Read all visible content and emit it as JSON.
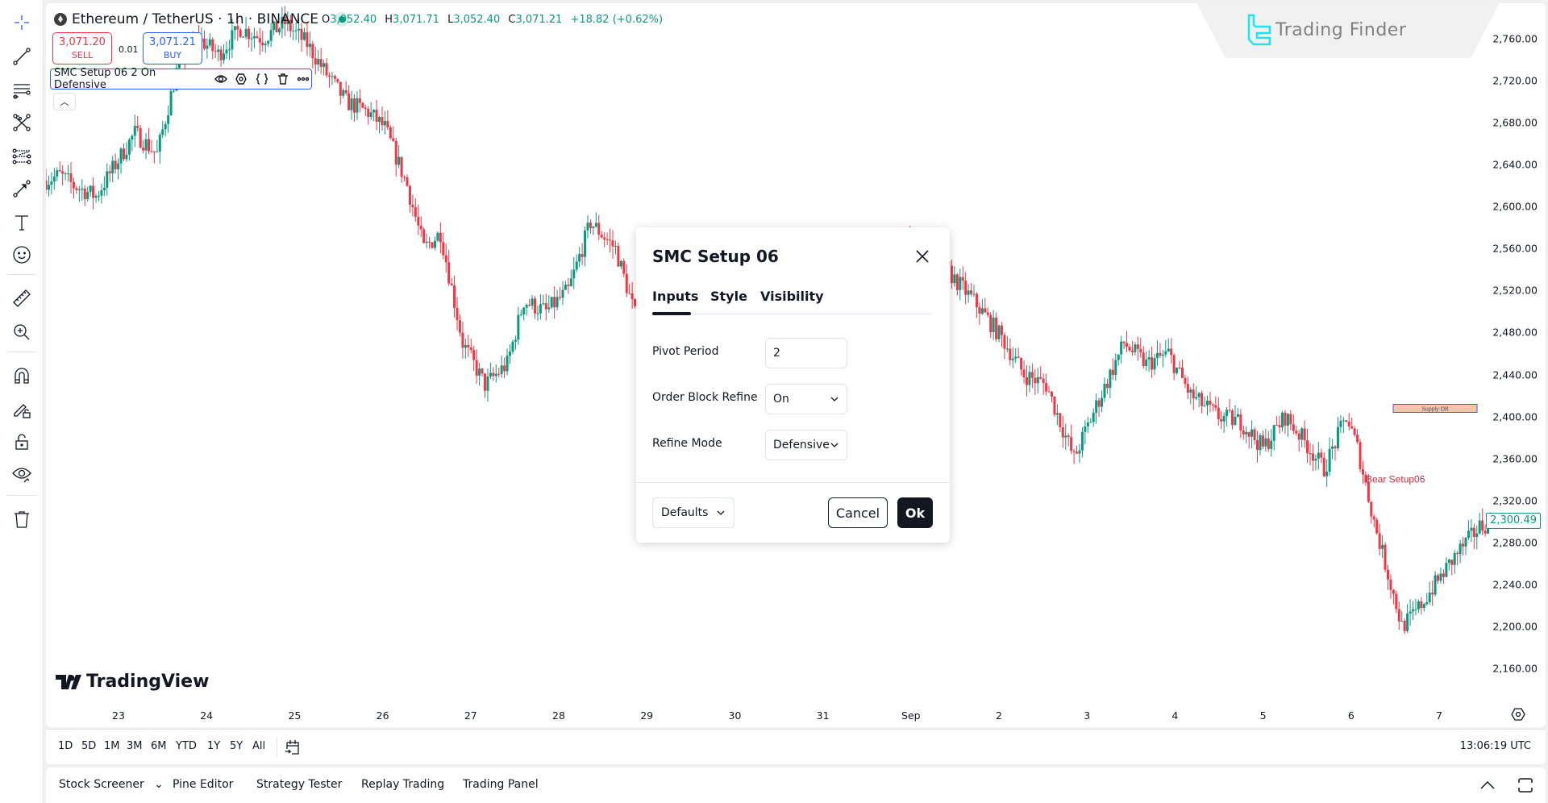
{
  "symbol": {
    "name": "Ethereum / TetherUS",
    "interval": "1h",
    "exchange": "BINANCE",
    "title": "Ethereum / TetherUS · 1h · BINANCE"
  },
  "ohlc": {
    "open_key": "O",
    "open": "3,052.40",
    "high_key": "H",
    "high": "3,071.71",
    "low_key": "L",
    "low": "3,052.40",
    "close_key": "C",
    "close": "3,071.21",
    "change": "+18.82 (+0.62%)"
  },
  "trade": {
    "sell_price": "3,071.20",
    "sell_label": "SELL",
    "spread": "0.01",
    "buy_price": "3,071.21",
    "buy_label": "BUY"
  },
  "indicator": {
    "label": "SMC Setup 06 2 On Defensive",
    "icons": [
      "eye-icon",
      "settings-icon",
      "source-code-icon",
      "delete-icon",
      "more-icon"
    ]
  },
  "watermarks": {
    "trading_finder": "Trading Finder",
    "tradingview": "TradingView"
  },
  "left_toolbar": [
    {
      "name": "crosshair-icon"
    },
    {
      "name": "trend-line-icon"
    },
    {
      "name": "horizontal-lines-icon"
    },
    {
      "name": "pattern-icon"
    },
    {
      "name": "fib-icon"
    },
    {
      "name": "arrow-brush-icon"
    },
    {
      "name": "text-icon"
    },
    {
      "name": "emoji-icon"
    },
    {
      "name": "ruler-icon"
    },
    {
      "name": "zoom-in-icon"
    },
    {
      "name": "magnet-icon"
    },
    {
      "name": "lock-drawing-icon"
    },
    {
      "name": "lock-icon"
    },
    {
      "name": "hide-icon"
    },
    {
      "name": "trash-icon"
    }
  ],
  "chart_data": {
    "type": "candlestick",
    "title": "Ethereum / TetherUS · 1h · BINANCE",
    "ylim": [
      2140,
      2790
    ],
    "y_ticks": [
      "2,760.00",
      "2,720.00",
      "2,680.00",
      "2,640.00",
      "2,600.00",
      "2,560.00",
      "2,520.00",
      "2,480.00",
      "2,440.00",
      "2,400.00",
      "2,360.00",
      "2,320.00",
      "2,280.00",
      "2,240.00",
      "2,200.00",
      "2,160.00"
    ],
    "y_tick_values": [
      2760,
      2720,
      2680,
      2640,
      2600,
      2560,
      2520,
      2480,
      2440,
      2400,
      2360,
      2320,
      2280,
      2240,
      2200,
      2160
    ],
    "x_ticks": [
      "23",
      "24",
      "25",
      "26",
      "27",
      "28",
      "29",
      "30",
      "31",
      "Sep",
      "2",
      "3",
      "4",
      "5",
      "6",
      "7"
    ],
    "last_price": "2,300.49",
    "last_price_value": 2300.49,
    "trend_points": [
      [
        0,
        2625
      ],
      [
        5,
        2630
      ],
      [
        10,
        2620
      ],
      [
        18,
        2610
      ],
      [
        25,
        2640
      ],
      [
        32,
        2670
      ],
      [
        40,
        2650
      ],
      [
        48,
        2740
      ],
      [
        55,
        2760
      ],
      [
        62,
        2745
      ],
      [
        70,
        2770
      ],
      [
        78,
        2760
      ],
      [
        86,
        2775
      ],
      [
        94,
        2755
      ],
      [
        100,
        2730
      ],
      [
        108,
        2700
      ],
      [
        116,
        2690
      ],
      [
        122,
        2675
      ],
      [
        130,
        2620
      ],
      [
        136,
        2560
      ],
      [
        142,
        2575
      ],
      [
        150,
        2470
      ],
      [
        158,
        2430
      ],
      [
        166,
        2450
      ],
      [
        172,
        2510
      ],
      [
        180,
        2500
      ],
      [
        188,
        2520
      ],
      [
        196,
        2585
      ],
      [
        205,
        2560
      ],
      [
        215,
        2470
      ],
      [
        225,
        2500
      ],
      [
        235,
        2480
      ],
      [
        245,
        2530
      ],
      [
        253,
        2480
      ],
      [
        262,
        2440
      ],
      [
        270,
        2410
      ],
      [
        278,
        2420
      ],
      [
        284,
        2450
      ],
      [
        292,
        2500
      ],
      [
        300,
        2520
      ],
      [
        308,
        2570
      ],
      [
        316,
        2545
      ],
      [
        324,
        2540
      ],
      [
        334,
        2510
      ],
      [
        344,
        2475
      ],
      [
        352,
        2440
      ],
      [
        360,
        2430
      ],
      [
        370,
        2360
      ],
      [
        378,
        2410
      ],
      [
        388,
        2470
      ],
      [
        396,
        2450
      ],
      [
        404,
        2460
      ],
      [
        412,
        2420
      ],
      [
        422,
        2400
      ],
      [
        430,
        2395
      ],
      [
        438,
        2370
      ],
      [
        446,
        2400
      ],
      [
        452,
        2380
      ],
      [
        460,
        2350
      ],
      [
        468,
        2400
      ],
      [
        472,
        2370
      ],
      [
        478,
        2300
      ],
      [
        484,
        2240
      ],
      [
        488,
        2200
      ],
      [
        492,
        2210
      ],
      [
        500,
        2240
      ],
      [
        508,
        2270
      ],
      [
        516,
        2295
      ],
      [
        520,
        2300
      ]
    ],
    "annotations": [
      {
        "type": "box",
        "label": "Supply OB",
        "price_top": 2407,
        "price_bottom": 2400,
        "color": "#f5c6a5",
        "border": "#2962ff"
      },
      {
        "type": "text",
        "label": "Bear Setup06",
        "price": 2340,
        "color": "#d12c3c"
      }
    ],
    "up_color": "#089981",
    "down_color": "#f23645"
  },
  "dialog": {
    "title": "SMC Setup 06",
    "tabs": [
      {
        "label": "Inputs",
        "active": true
      },
      {
        "label": "Style",
        "active": false
      },
      {
        "label": "Visibility",
        "active": false
      }
    ],
    "fields": [
      {
        "label": "Pivot Period",
        "value": "2",
        "type": "number"
      },
      {
        "label": "Order Block Refine",
        "value": "On",
        "type": "select"
      },
      {
        "label": "Refine Mode",
        "value": "Defensive",
        "type": "select"
      }
    ],
    "defaults_label": "Defaults",
    "cancel_label": "Cancel",
    "ok_label": "Ok"
  },
  "range_bar": {
    "ranges": [
      "1D",
      "5D",
      "1M",
      "3M",
      "6M",
      "YTD",
      "1Y",
      "5Y",
      "All"
    ],
    "clock": "13:06:19 UTC"
  },
  "bottom_panel": {
    "tabs": [
      "Stock Screener",
      "Pine Editor",
      "Strategy Tester",
      "Replay Trading",
      "Trading Panel"
    ]
  }
}
